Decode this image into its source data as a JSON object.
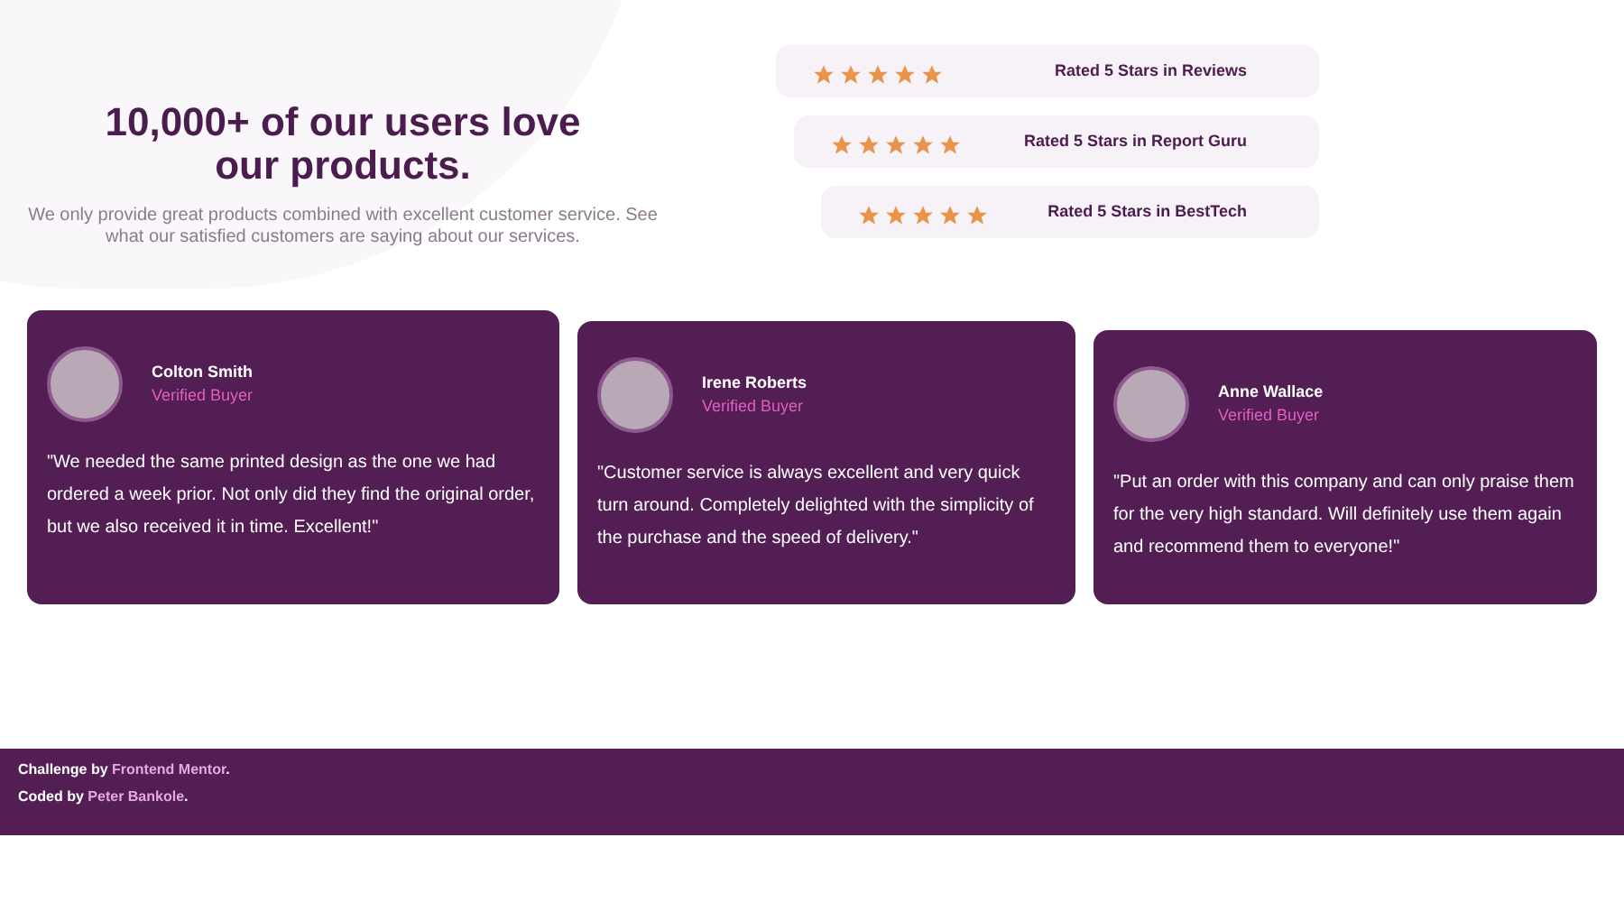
{
  "hero": {
    "title": "10,000+ of our users love our products.",
    "description": "We only provide great products combined with excellent customer service. See what our satisfied customers are saying about our services."
  },
  "ratings": [
    {
      "stars": 5,
      "label": "Rated 5 Stars in Reviews"
    },
    {
      "stars": 5,
      "label": "Rated 5 Stars in Report Guru"
    },
    {
      "stars": 5,
      "label": "Rated 5 Stars in BestTech"
    }
  ],
  "testimonials": [
    {
      "name": "Colton Smith",
      "role": "Verified Buyer",
      "quote": "\"We needed the same printed design as the one we had ordered a week prior. Not only did they find the original order, but we also received it in time. Excellent!\""
    },
    {
      "name": "Irene Roberts",
      "role": "Verified Buyer",
      "quote": "\"Customer service is always excellent and very quick turn around. Completely delighted with the simplicity of the purchase and the speed of delivery.\""
    },
    {
      "name": "Anne Wallace",
      "role": "Verified Buyer",
      "quote": "\"Put an order with this company and can only praise them for the very high standard. Will definitely use them again and recommend them to everyone!\""
    }
  ],
  "footer": [
    {
      "prefix": "Challenge by ",
      "link": "Frontend Mentor",
      "suffix": "."
    },
    {
      "prefix": "Coded by ",
      "link": "Peter Bankole",
      "suffix": "."
    }
  ]
}
